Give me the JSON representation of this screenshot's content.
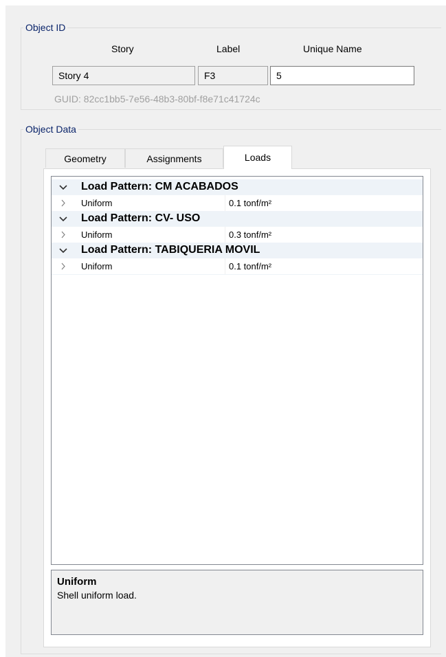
{
  "object_id": {
    "legend": "Object ID",
    "headers": {
      "story": "Story",
      "label": "Label",
      "unique_name": "Unique Name"
    },
    "values": {
      "story": "Story 4",
      "label": "F3",
      "unique_name": "5"
    },
    "guid": "GUID:  82cc1bb5-7e56-48b3-80bf-f8e71c41724c"
  },
  "object_data": {
    "legend": "Object Data",
    "tabs": [
      {
        "label": "Geometry",
        "active": false
      },
      {
        "label": "Assignments",
        "active": false
      },
      {
        "label": "Loads",
        "active": true
      }
    ],
    "grid": {
      "categories": [
        {
          "title": "Load Pattern: CM ACABADOS",
          "rows": [
            {
              "name": "Uniform",
              "value": "0.1 tonf/m²"
            }
          ]
        },
        {
          "title": "Load Pattern: CV- USO",
          "rows": [
            {
              "name": "Uniform",
              "value": "0.3 tonf/m²"
            }
          ]
        },
        {
          "title": "Load Pattern: TABIQUERIA MOVIL",
          "rows": [
            {
              "name": "Uniform",
              "value": "0.1 tonf/m²"
            }
          ]
        }
      ]
    },
    "description": {
      "title": "Uniform",
      "text": "Shell uniform load."
    }
  },
  "icons": {
    "category_toggle": "chevron-down-icon",
    "row_expand": "chevron-right-icon"
  }
}
